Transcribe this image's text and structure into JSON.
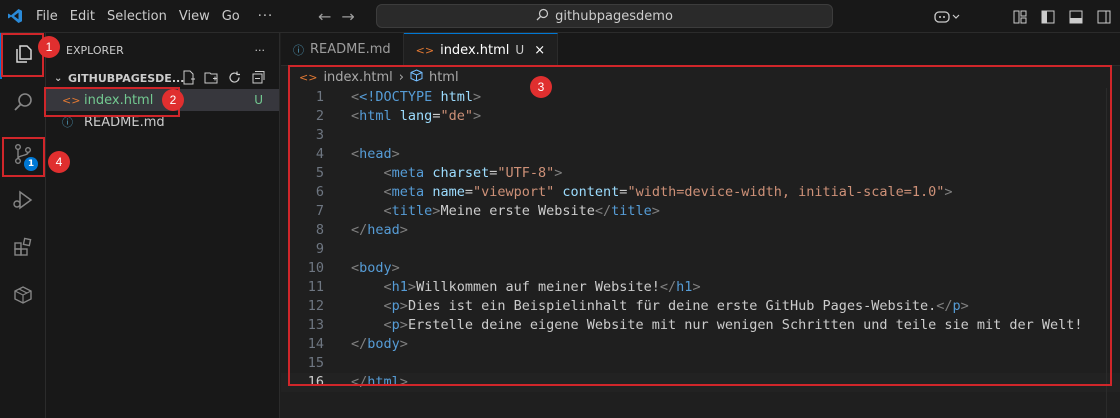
{
  "menu": [
    "File",
    "Edit",
    "Selection",
    "View",
    "Go",
    "···"
  ],
  "search": {
    "text": "githubpagesdemo"
  },
  "explorer": {
    "title": "EXPLORER",
    "more": "···",
    "folder": "GITHUBPAGESDE...",
    "files": [
      {
        "name": "index.html",
        "status": "U",
        "icon": "html-file-icon"
      },
      {
        "name": "README.md",
        "status": "",
        "icon": "info-icon"
      }
    ]
  },
  "activity": {
    "scm_badge": "1"
  },
  "tabs": [
    {
      "label": "README.md",
      "modified": ""
    },
    {
      "label": "index.html",
      "modified": "U",
      "close": "×"
    }
  ],
  "breadcrumb": {
    "file": "index.html",
    "symbol": "html"
  },
  "code": {
    "lines": [
      "1",
      "2",
      "3",
      "4",
      "5",
      "6",
      "7",
      "8",
      "9",
      "10",
      "11",
      "12",
      "13",
      "14",
      "15",
      "16"
    ],
    "l1_doctype": "<!DOCTYPE",
    "l1_html": "html",
    "l2_lang": "lang",
    "l2_val": "\"de\"",
    "l5_charset_val": "\"UTF-8\"",
    "l6_name_val": "\"viewport\"",
    "l6_content_val": "\"width=device-width, initial-scale=1.0\"",
    "l7_title_text": "Meine erste Website",
    "l11_h1_text": "Willkommen auf meiner Website!",
    "l12_p_text": "Dies ist ein Beispielinhalt für deine erste GitHub Pages-Website.",
    "l13_p_text": "Erstelle deine eigene Website mit nur wenigen Schritten und teile sie mit der Welt!"
  },
  "annotations": [
    "1",
    "2",
    "3",
    "4"
  ],
  "colors": {
    "accent": "#0078d4",
    "callout": "#d0262a",
    "untracked": "#73c991"
  }
}
